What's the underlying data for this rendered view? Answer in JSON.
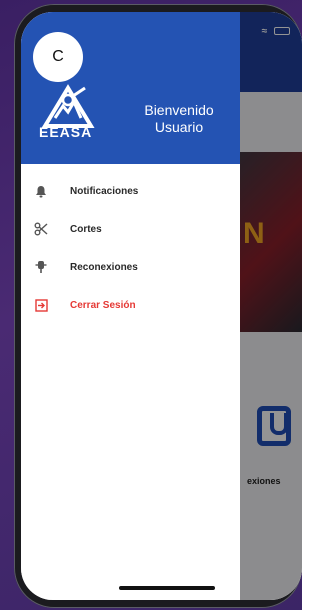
{
  "app": {
    "banner_text": "N",
    "tile_label": "exiones"
  },
  "drawer": {
    "avatar_initial": "C",
    "logo_text": "EEASA",
    "welcome_line1": "Bienvenido",
    "welcome_line2": "Usuario",
    "items": [
      {
        "label": "Notificaciones",
        "icon": "bell-icon"
      },
      {
        "label": "Cortes",
        "icon": "scissors-icon"
      },
      {
        "label": "Reconexiones",
        "icon": "plug-icon"
      },
      {
        "label": "Cerrar Sesión",
        "icon": "logout-icon"
      }
    ]
  },
  "colors": {
    "header_blue": "#2453b3",
    "logout_red": "#e53935"
  }
}
